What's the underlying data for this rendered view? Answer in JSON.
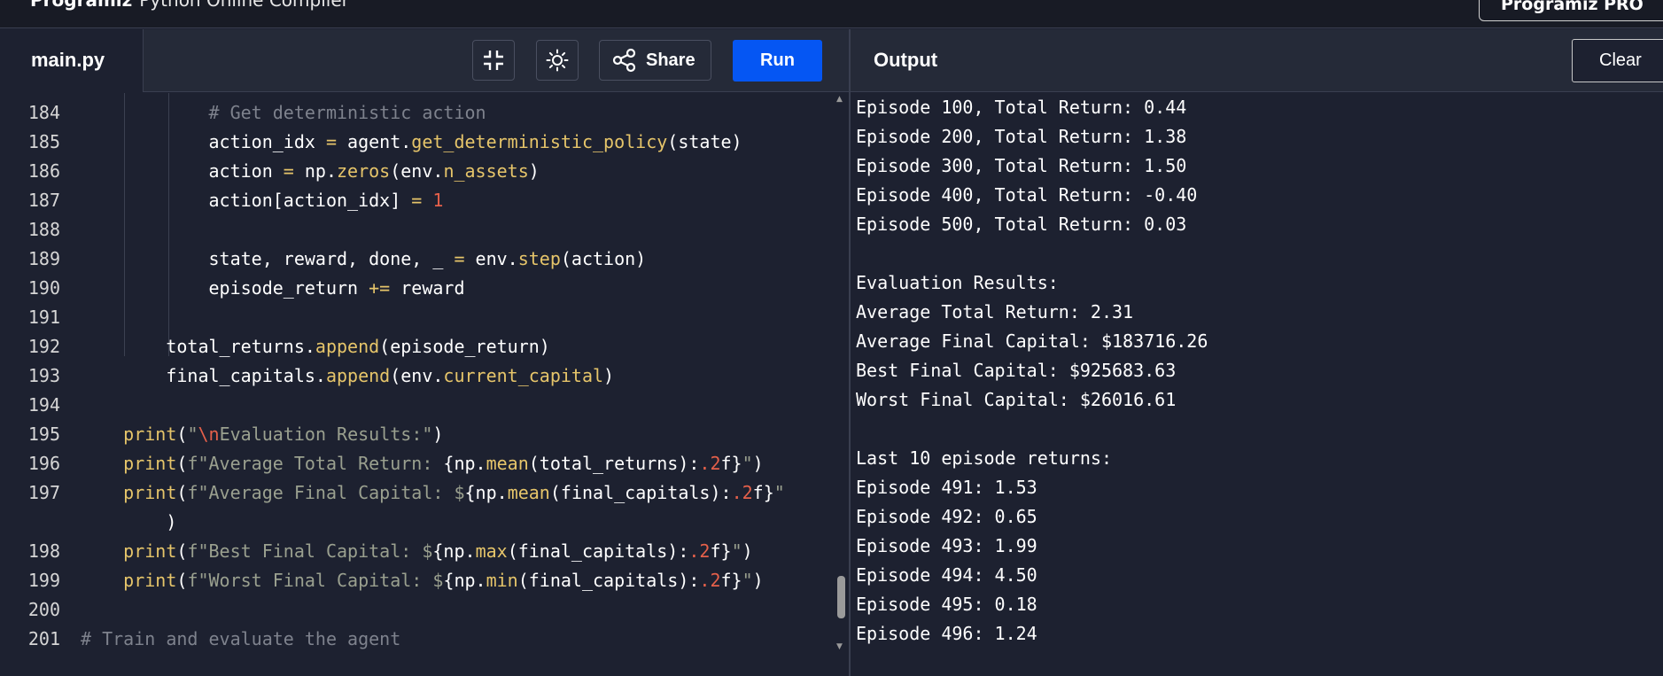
{
  "topbar": {
    "brand_name": "Programiz",
    "brand_subtitle": "Python Online Compiler",
    "pro_label": "Programiz PRO"
  },
  "editor": {
    "file_tab": "main.py",
    "share_label": "Share",
    "run_label": "Run",
    "line_numbers": [
      "184",
      "185",
      "186",
      "187",
      "188",
      "189",
      "190",
      "191",
      "192",
      "193",
      "194",
      "195",
      "196",
      "197",
      "",
      "198",
      "199",
      "200",
      "201"
    ]
  },
  "output_panel": {
    "title": "Output",
    "clear_label": "Clear",
    "lines": [
      "Episode 100, Total Return: 0.44",
      "Episode 200, Total Return: 1.38",
      "Episode 300, Total Return: 1.50",
      "Episode 400, Total Return: -0.40",
      "Episode 500, Total Return: 0.03",
      "",
      "Evaluation Results:",
      "Average Total Return: 2.31",
      "Average Final Capital: $183716.26",
      "Best Final Capital: $925683.63",
      "Worst Final Capital: $26016.61",
      "",
      "Last 10 episode returns:",
      "Episode 491: 1.53",
      "Episode 492: 0.65",
      "Episode 493: 1.99",
      "Episode 494: 4.50",
      "Episode 495: 0.18",
      "Episode 496: 1.24"
    ]
  },
  "code_tokens": {
    "l184": [
      [
        "            ",
        ""
      ],
      [
        "# Get deterministic action",
        "cm"
      ]
    ],
    "l185": [
      [
        "            action_idx ",
        ""
      ],
      [
        "=",
        "op"
      ],
      [
        " agent.",
        ""
      ],
      [
        "get_deterministic_policy",
        "fn"
      ],
      [
        "(state)",
        ""
      ]
    ],
    "l186": [
      [
        "            action ",
        ""
      ],
      [
        "=",
        "op"
      ],
      [
        " np.",
        ""
      ],
      [
        "zeros",
        "fn"
      ],
      [
        "(env.",
        ""
      ],
      [
        "n_assets",
        "at"
      ],
      [
        ")",
        ""
      ]
    ],
    "l187": [
      [
        "            action[action_idx] ",
        ""
      ],
      [
        "=",
        "op"
      ],
      [
        " ",
        ""
      ],
      [
        "1",
        "nu"
      ]
    ],
    "l188": [],
    "l189": [
      [
        "            state, reward, done, _ ",
        ""
      ],
      [
        "=",
        "op"
      ],
      [
        " env.",
        ""
      ],
      [
        "step",
        "fn"
      ],
      [
        "(action)",
        ""
      ]
    ],
    "l190": [
      [
        "            episode_return ",
        ""
      ],
      [
        "+=",
        "op"
      ],
      [
        " reward",
        ""
      ]
    ],
    "l191": [],
    "l192": [
      [
        "        total_returns.",
        ""
      ],
      [
        "append",
        "fn"
      ],
      [
        "(episode_return)",
        ""
      ]
    ],
    "l193": [
      [
        "        final_capitals.",
        ""
      ],
      [
        "append",
        "fn"
      ],
      [
        "(env.",
        ""
      ],
      [
        "current_capital",
        "at"
      ],
      [
        ")",
        ""
      ]
    ],
    "l194": [],
    "l195": [
      [
        "    ",
        ""
      ],
      [
        "print",
        "fn"
      ],
      [
        "(",
        ""
      ],
      [
        "\"",
        "st"
      ],
      [
        "\\n",
        "es"
      ],
      [
        "Evaluation Results:\"",
        "st"
      ],
      [
        ")",
        ""
      ]
    ],
    "l196": [
      [
        "    ",
        ""
      ],
      [
        "print",
        "fn"
      ],
      [
        "(",
        ""
      ],
      [
        "f\"Average Total Return: ",
        "st"
      ],
      [
        "{np.",
        ""
      ],
      [
        "mean",
        "fn"
      ],
      [
        "(total_returns):",
        ""
      ],
      [
        ".2",
        "nu"
      ],
      [
        "f}",
        ""
      ],
      [
        "\"",
        "st"
      ],
      [
        ")",
        ""
      ]
    ],
    "l197": [
      [
        "    ",
        ""
      ],
      [
        "print",
        "fn"
      ],
      [
        "(",
        ""
      ],
      [
        "f\"Average Final Capital: $",
        "st"
      ],
      [
        "{np.",
        ""
      ],
      [
        "mean",
        "fn"
      ],
      [
        "(final_capitals):",
        ""
      ],
      [
        ".2",
        "nu"
      ],
      [
        "f}",
        ""
      ],
      [
        "\"",
        "st"
      ]
    ],
    "l197b": [
      [
        "        )",
        ""
      ]
    ],
    "l198": [
      [
        "    ",
        ""
      ],
      [
        "print",
        "fn"
      ],
      [
        "(",
        ""
      ],
      [
        "f\"Best Final Capital: $",
        "st"
      ],
      [
        "{np.",
        ""
      ],
      [
        "max",
        "fn"
      ],
      [
        "(final_capitals):",
        ""
      ],
      [
        ".2",
        "nu"
      ],
      [
        "f}",
        ""
      ],
      [
        "\"",
        "st"
      ],
      [
        ")",
        ""
      ]
    ],
    "l199": [
      [
        "    ",
        ""
      ],
      [
        "print",
        "fn"
      ],
      [
        "(",
        ""
      ],
      [
        "f\"Worst Final Capital: $",
        "st"
      ],
      [
        "{np.",
        ""
      ],
      [
        "min",
        "fn"
      ],
      [
        "(final_capitals):",
        ""
      ],
      [
        ".2",
        "nu"
      ],
      [
        "f}",
        ""
      ],
      [
        "\"",
        "st"
      ],
      [
        ")",
        ""
      ]
    ],
    "l200": [],
    "l201": [
      [
        "# Train and evaluate the agent",
        "cm"
      ]
    ]
  }
}
